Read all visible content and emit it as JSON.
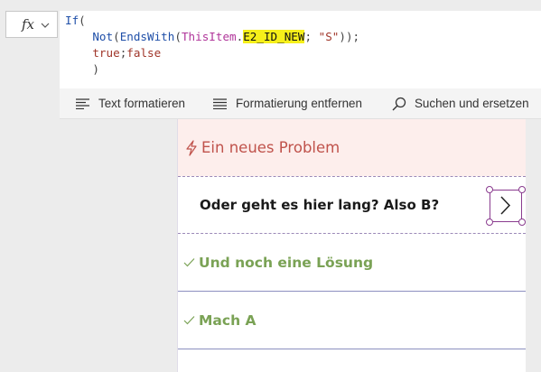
{
  "formula_bar": {
    "fx_label": "fx",
    "lines": [
      "If(",
      "    Not(EndsWith(ThisItem.E2_ID_NEW; \"S\"));",
      "    true;false",
      "    )"
    ],
    "highlighted_token": "E2_ID_NEW"
  },
  "toolbar": {
    "format_text": "Text formatieren",
    "remove_formatting": "Formatierung entfernen",
    "find_replace": "Suchen und ersetzen"
  },
  "gallery": {
    "rows": [
      {
        "label": "Ein neues Problem",
        "kind": "problem",
        "icon": "lightning-icon"
      },
      {
        "label": "Oder geht es hier lang? Also B?",
        "kind": "selected"
      },
      {
        "label": "Und noch eine Lösung",
        "kind": "solution",
        "icon": "check-icon"
      },
      {
        "label": "Mach A",
        "kind": "solution",
        "icon": "check-icon"
      }
    ]
  },
  "colors": {
    "highlight": "#f6ef1a",
    "problem_text": "#c0534c",
    "solution_text": "#7aa255",
    "selection": "#8a3c8f"
  }
}
